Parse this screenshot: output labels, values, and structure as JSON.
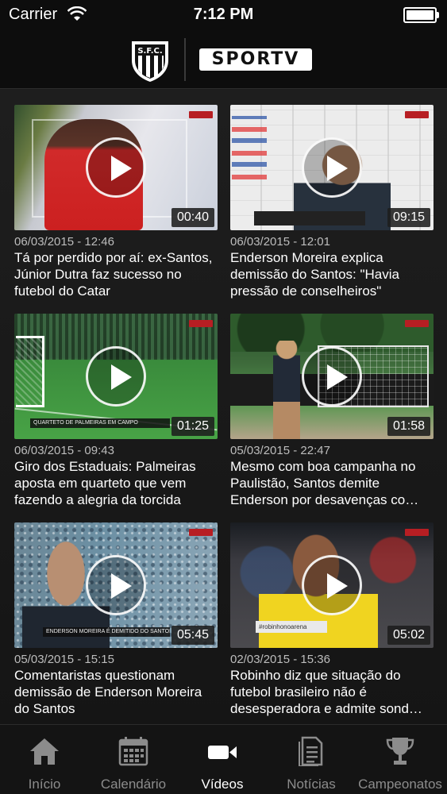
{
  "status_bar": {
    "carrier": "Carrier",
    "time": "7:12 PM",
    "battery_level": 1.0
  },
  "header": {
    "logo_left": {
      "icon": "santos-crest-logo",
      "text": "S.F.C."
    },
    "logo_right": {
      "icon": "sportv-logo",
      "text": "SPORTV"
    }
  },
  "videos": [
    {
      "date": "06/03/2015 - 12:46",
      "title": "Tá por perdido por aí: ex-Santos, Júnior Dutra faz sucesso no futebol do Catar",
      "duration": "00:40"
    },
    {
      "date": "06/03/2015 - 12:01",
      "title": "Enderson Moreira explica demissão do Santos: \"Havia pressão de conselheiros\"",
      "duration": "09:15"
    },
    {
      "date": "06/03/2015 - 09:43",
      "title": "Giro dos Estaduais: Palmeiras aposta em quarteto que vem fazendo a alegria da torcida",
      "duration": "01:25"
    },
    {
      "date": "05/03/2015 - 22:47",
      "title": "Mesmo com boa campanha no Paulistão, Santos demite Enderson por desavenças co…",
      "duration": "01:58"
    },
    {
      "date": "05/03/2015 - 15:15",
      "title": "Comentaristas questionam demissão de Enderson Moreira do Santos",
      "duration": "05:45"
    },
    {
      "date": "02/03/2015 - 15:36",
      "title": "Robinho diz que situação do futebol brasileiro não é desesperadora e admite sond…",
      "duration": "05:02"
    }
  ],
  "thumbnail_overlays": {
    "banner_3": "QUARTETO DE PALMEIRAS EM CAMPO",
    "banner_5": "ENDERSON MOREIRA É DEMITIDO DO SANTOS",
    "hashtag_6": "#robinhonoarena"
  },
  "tabs": [
    {
      "label": "Início",
      "icon": "home-icon",
      "active": false
    },
    {
      "label": "Calendário",
      "icon": "calendar-icon",
      "active": false
    },
    {
      "label": "Vídeos",
      "icon": "video-camera-icon",
      "active": true
    },
    {
      "label": "Notícias",
      "icon": "news-document-icon",
      "active": false
    },
    {
      "label": "Campeonatos",
      "icon": "trophy-icon",
      "active": false
    }
  ],
  "colors": {
    "background": "#1a1a1a",
    "header": "#0d0d0d",
    "tab_active": "#ffffff",
    "tab_inactive": "#8c8c8c",
    "accent_red": "#b71e23"
  }
}
